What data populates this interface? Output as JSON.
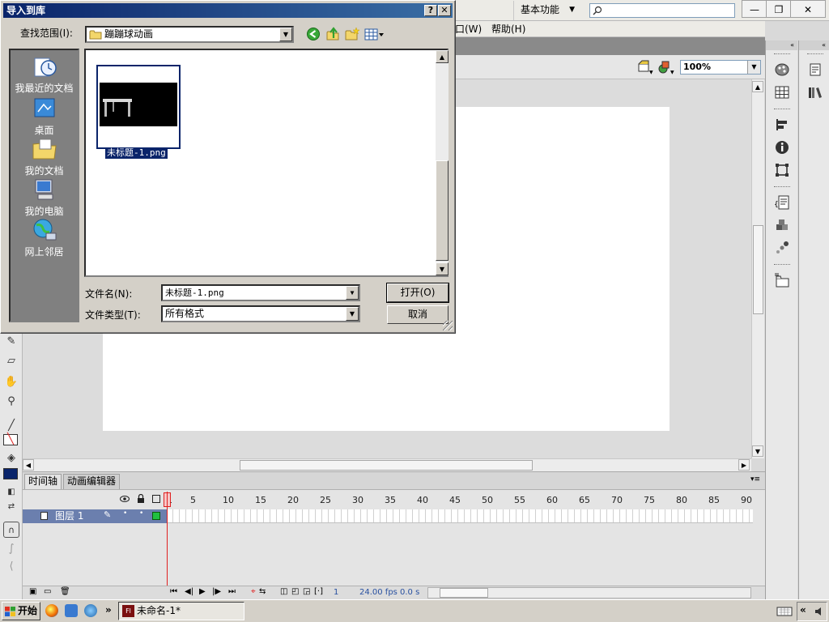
{
  "app": {
    "workspace": "基本功能",
    "menu": {
      "window": "口(W)",
      "help": "帮助(H)"
    },
    "zoom": "100%",
    "win_min": "—",
    "win_restore": "❐",
    "win_close": "✕"
  },
  "timeline": {
    "tabs": [
      "时间轴",
      "动画编辑器"
    ],
    "frame_numbers": [
      "1",
      "5",
      "10",
      "15",
      "20",
      "25",
      "30",
      "35",
      "40",
      "45",
      "50",
      "55",
      "60",
      "65",
      "70",
      "75",
      "80",
      "85",
      "90"
    ],
    "layer_name": "图层 1",
    "status": {
      "frame": "1",
      "fps": "24.00 fps",
      "time": "0.0 s"
    }
  },
  "taskbar": {
    "start": "开始",
    "task": "未命名-1*",
    "more": "»",
    "tray_more": "«"
  },
  "dialog": {
    "title": "导入到库",
    "help_btn": "?",
    "close_btn": "✕",
    "lookin_label": "查找范围(I):",
    "lookin_value": "蹦蹦球动画",
    "places": [
      "我最近的文档",
      "桌面",
      "我的文档",
      "我的电脑",
      "网上邻居"
    ],
    "file": {
      "name": "未标题-1.png"
    },
    "filename_label": "文件名(N):",
    "filename_value": "未标题-1.png",
    "filetype_label": "文件类型(T):",
    "filetype_value": "所有格式",
    "open_btn": "打开(O)",
    "cancel_btn": "取消"
  },
  "colors": {
    "title_bar": "#0a246a",
    "selection": "#0a246a",
    "layer_row": "#6b7fae",
    "playhead": "#e02020"
  }
}
